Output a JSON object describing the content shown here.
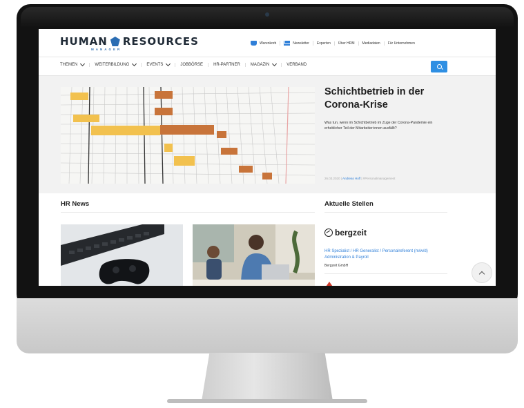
{
  "header": {
    "logo_main": "HUMAN",
    "logo_main2": "RESOURCES",
    "logo_sub": "MANAGER",
    "top_links": [
      "Warenkorb",
      "Newsletter",
      "Experten",
      "Über HRM",
      "Mediadaten",
      "Für Unternehmen"
    ]
  },
  "nav": {
    "items": [
      {
        "label": "THEMEN",
        "dropdown": true
      },
      {
        "label": "WEITERBILDUNG",
        "dropdown": true
      },
      {
        "label": "EVENTS",
        "dropdown": true
      },
      {
        "label": "JOBBÖRSE",
        "dropdown": false
      },
      {
        "label": "HR-PARTNER",
        "dropdown": false
      },
      {
        "label": "MAGAZIN",
        "dropdown": true
      },
      {
        "label": "VERBAND",
        "dropdown": false
      }
    ],
    "search_icon": "search-icon"
  },
  "hero": {
    "title": "Schichtbetrieb in der Corona-Krise",
    "text": "Was tun, wenn im Schichtbetrieb im Zuge der Corona-Pandemie ein erheblicher Teil der Mitarbeiter:innen ausfällt?",
    "date": "26.03.2020",
    "author": "Andreas Hoff",
    "tag": "#Personalmanagement"
  },
  "news": {
    "title": "HR News"
  },
  "jobs": {
    "title": "Aktuelle Stellen",
    "company_logo": "bergzeit",
    "job_title": "HR Spezialist / HR Generalist / Personalreferent (m/w/d) Administration & Payroll",
    "company": "Bergzeit GmbH"
  },
  "colors": {
    "accent": "#2f8fe3",
    "text": "#1f1f1f",
    "schedule_yellow": "#f2c14e",
    "schedule_brown": "#c8743a"
  }
}
